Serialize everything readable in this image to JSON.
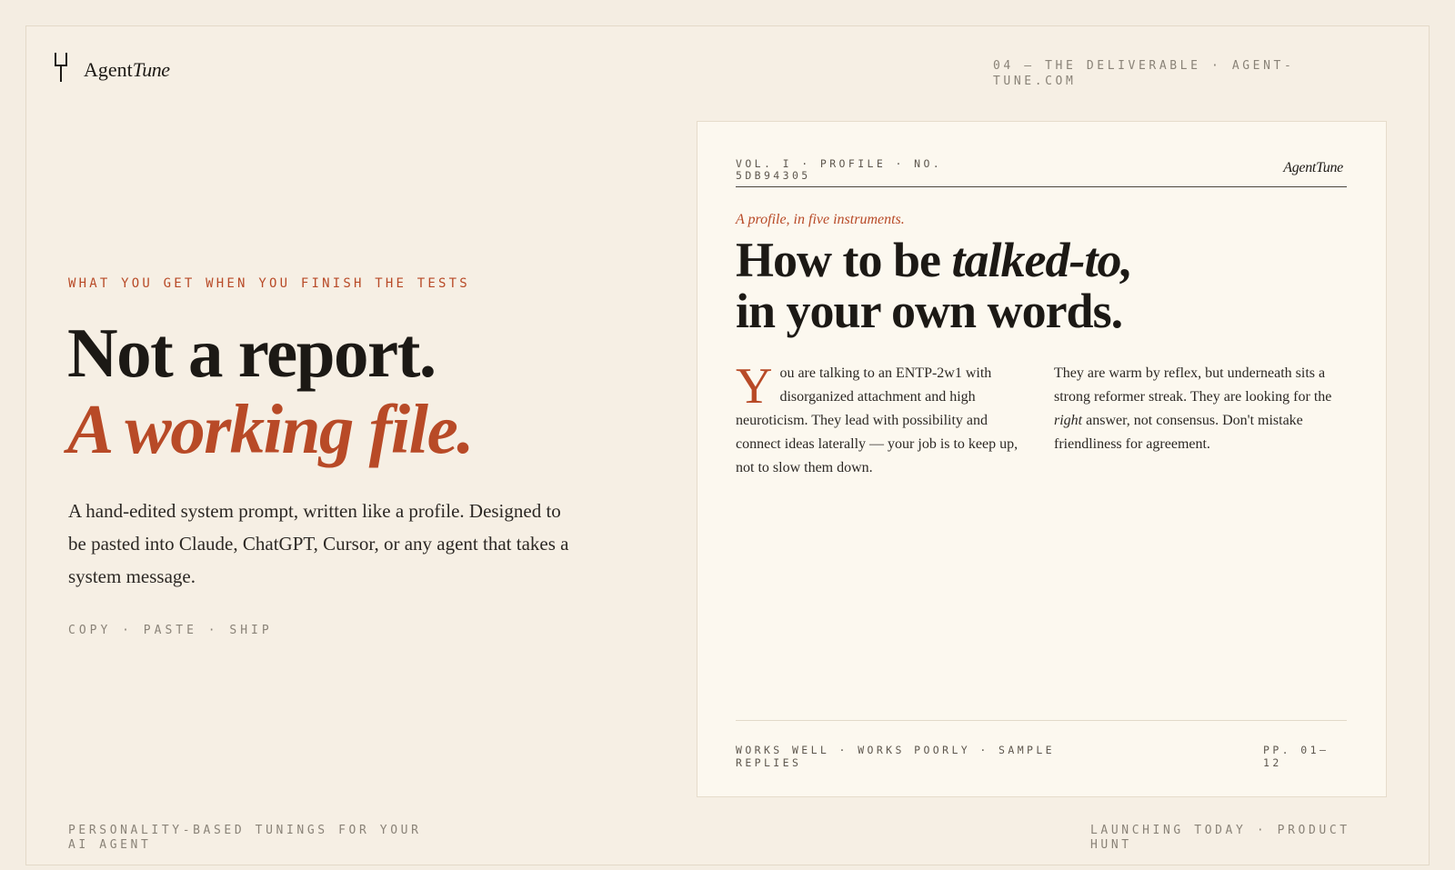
{
  "brand": {
    "name_plain": "Agent",
    "name_italic": "Tune",
    "icon": "tuning-fork-icon"
  },
  "header": {
    "meta": "04 — THE DELIVERABLE · AGENT-TUNE.COM"
  },
  "hero": {
    "eyebrow": "WHAT YOU GET WHEN YOU FINISH THE TESTS",
    "headline_line1": "Not a report.",
    "headline_line2": "A working file.",
    "lede": "A hand-edited system prompt, written like a profile. Designed to be pasted into Claude, ChatGPT, Cursor, or any agent that takes a system message.",
    "steps": "COPY · PASTE · SHIP"
  },
  "card": {
    "vol": "VOL. I · PROFILE · NO. 5DB94305",
    "brand": "AgentTune",
    "kicker": "A profile, in five instruments.",
    "title_line1_plain": "How to be ",
    "title_line1_italic": "talked-to,",
    "title_line2": "in your own words.",
    "col1_dropcap": "Y",
    "col1_text": "ou are talking to an ENTP-2w1 with disorganized attachment and high neuroticism. They lead with possibility and connect ideas laterally — your job is to keep up, not to slow them down.",
    "col2_before": "They are warm by reflex, but underneath sits a strong reformer streak. They are looking for the ",
    "col2_italic": "right",
    "col2_after": " answer, not consensus. Don't mistake friendliness for agreement.",
    "footer_left": "WORKS WELL · WORKS POORLY · SAMPLE REPLIES",
    "footer_right": "PP. 01–12"
  },
  "footer": {
    "left": "PERSONALITY-BASED TUNINGS FOR YOUR AI AGENT",
    "right": "LAUNCHING TODAY · PRODUCT HUNT"
  },
  "colors": {
    "accent": "#b84a27",
    "background": "#f4ede2",
    "card": "#fcf8ef",
    "ink": "#1c1915",
    "muted": "#8a8378"
  }
}
